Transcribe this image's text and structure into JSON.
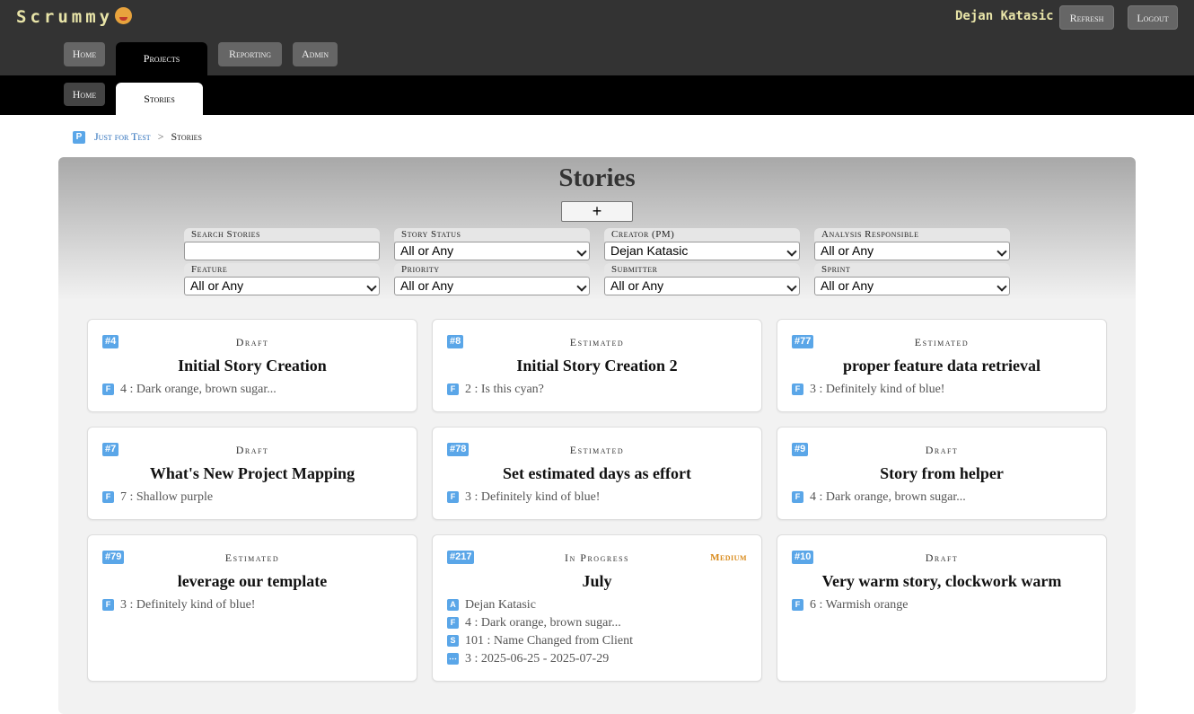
{
  "app": {
    "name": "Scrummy"
  },
  "user": {
    "name": "Dejan Katasic"
  },
  "top_buttons": {
    "refresh": "Refresh",
    "logout": "Logout"
  },
  "main_nav": [
    {
      "label": "Home"
    },
    {
      "label": "Projects",
      "active": true
    },
    {
      "label": "Reporting"
    },
    {
      "label": "Admin"
    }
  ],
  "sub_nav": [
    {
      "label": "Home"
    },
    {
      "label": "Stories",
      "active": true
    }
  ],
  "breadcrumb": {
    "badge": "P",
    "project": "Just for Test",
    "separator": ">",
    "current": "Stories"
  },
  "page": {
    "title": "Stories",
    "add_label": "+"
  },
  "filters": [
    {
      "label": "Search Stories",
      "value": ""
    },
    {
      "label": "Story Status",
      "value": "All or Any"
    },
    {
      "label": "Creator (PM)",
      "value": "Dejan Katasic"
    },
    {
      "label": "Analysis Responsible",
      "value": "All or Any"
    },
    {
      "label": "Feature",
      "value": "All or Any"
    },
    {
      "label": "Priority",
      "value": "All or Any"
    },
    {
      "label": "Submitter",
      "value": "All or Any"
    },
    {
      "label": "Sprint",
      "value": "All or Any"
    }
  ],
  "stories": [
    {
      "id": "#4",
      "status": "Draft",
      "priority": "",
      "title": "Initial Story Creation",
      "meta": [
        {
          "icon": "F",
          "text": "4 : Dark orange, brown sugar..."
        }
      ]
    },
    {
      "id": "#8",
      "status": "Estimated",
      "priority": "",
      "title": "Initial Story Creation 2",
      "meta": [
        {
          "icon": "F",
          "text": "2 : Is this cyan?"
        }
      ]
    },
    {
      "id": "#77",
      "status": "Estimated",
      "priority": "",
      "title": "proper feature data retrieval",
      "meta": [
        {
          "icon": "F",
          "text": "3 : Definitely kind of blue!"
        }
      ]
    },
    {
      "id": "#7",
      "status": "Draft",
      "priority": "",
      "title": "What's New Project Mapping",
      "meta": [
        {
          "icon": "F",
          "text": "7 : Shallow purple"
        }
      ]
    },
    {
      "id": "#78",
      "status": "Estimated",
      "priority": "",
      "title": "Set estimated days as effort",
      "meta": [
        {
          "icon": "F",
          "text": "3 : Definitely kind of blue!"
        }
      ]
    },
    {
      "id": "#9",
      "status": "Draft",
      "priority": "",
      "title": "Story from helper",
      "meta": [
        {
          "icon": "F",
          "text": "4 : Dark orange, brown sugar..."
        }
      ]
    },
    {
      "id": "#79",
      "status": "Estimated",
      "priority": "",
      "title": "leverage our template",
      "meta": [
        {
          "icon": "F",
          "text": "3 : Definitely kind of blue!"
        }
      ]
    },
    {
      "id": "#217",
      "status": "In Progress",
      "priority": "Medium",
      "title": "July",
      "meta": [
        {
          "icon": "A",
          "text": "Dejan Katasic"
        },
        {
          "icon": "F",
          "text": "4 : Dark orange, brown sugar..."
        },
        {
          "icon": "S",
          "text": "101 : Name Changed from Client"
        },
        {
          "icon": "⋯",
          "text": "3 : 2025-06-25 - 2025-07-29"
        }
      ]
    },
    {
      "id": "#10",
      "status": "Draft",
      "priority": "",
      "title": "Very warm story, clockwork warm",
      "meta": [
        {
          "icon": "F",
          "text": "6 : Warmish orange"
        }
      ]
    }
  ]
}
